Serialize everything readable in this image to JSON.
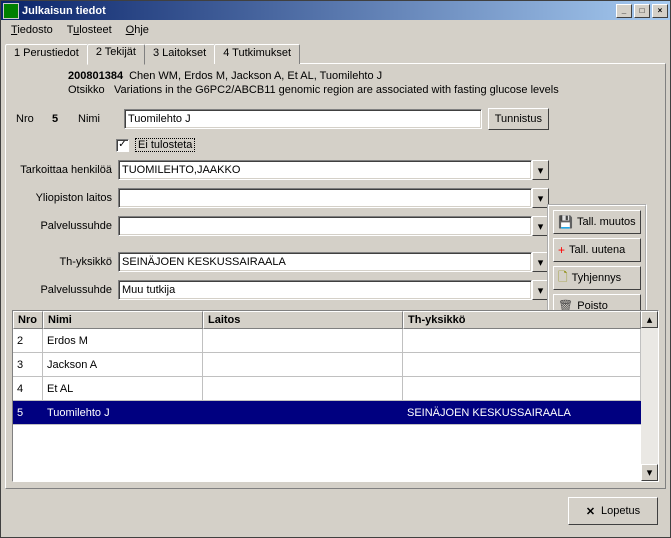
{
  "window": {
    "title": "Julkaisun tiedot"
  },
  "menu": {
    "file": "Tiedosto",
    "outputs": "Tulosteet",
    "help": "Ohje"
  },
  "tabs": {
    "t1": "1 Perustiedot",
    "t2": "2 Tekijät",
    "t3": "3 Laitokset",
    "t4": "4 Tutkimukset"
  },
  "header": {
    "id": "200801384",
    "authors": "Chen WM, Erdos M, Jackson A, Et AL, Tuomilehto J",
    "otsikko_lbl": "Otsikko",
    "title": "Variations in the G6PC2/ABCB11 genomic region are associated with fasting glucose levels"
  },
  "form": {
    "nro_lbl": "Nro",
    "nro_val": "5",
    "nimi_lbl": "Nimi",
    "nimi_val": "Tuomilehto J",
    "tunnistus_btn": "Tunnistus",
    "eitulosteta_lbl": "Ei tulosteta",
    "tarkoittaa_lbl": "Tarkoittaa henkilöä",
    "tarkoittaa_val": "TUOMILEHTO,JAAKKO",
    "yliopiston_lbl": "Yliopiston laitos",
    "yliopiston_val": "",
    "palvelussuhde1_lbl": "Palvelussuhde",
    "palvelussuhde1_val": "",
    "thyksikko_lbl": "Th-yksikkö",
    "thyksikko_val": "SEINÄJOEN KESKUSSAIRAALA",
    "palvelussuhde2_lbl": "Palvelussuhde",
    "palvelussuhde2_val": "Muu tutkija"
  },
  "sidebtns": {
    "save": "Tall. muutos",
    "savenew": "Tall. uutena",
    "clear": "Tyhjennys",
    "delete": "Poisto"
  },
  "table": {
    "h_nro": "Nro",
    "h_nimi": "Nimi",
    "h_laitos": "Laitos",
    "h_tyk": "Th-yksikkö",
    "rows": [
      {
        "nro": "2",
        "nimi": "Erdos M",
        "laitos": "",
        "tyk": ""
      },
      {
        "nro": "3",
        "nimi": "Jackson A",
        "laitos": "",
        "tyk": ""
      },
      {
        "nro": "4",
        "nimi": "Et AL",
        "laitos": "",
        "tyk": ""
      },
      {
        "nro": "5",
        "nimi": "Tuomilehto J",
        "laitos": "",
        "tyk": "SEINÄJOEN KESKUSSAIRAALA"
      }
    ]
  },
  "footer": {
    "close": "Lopetus"
  }
}
